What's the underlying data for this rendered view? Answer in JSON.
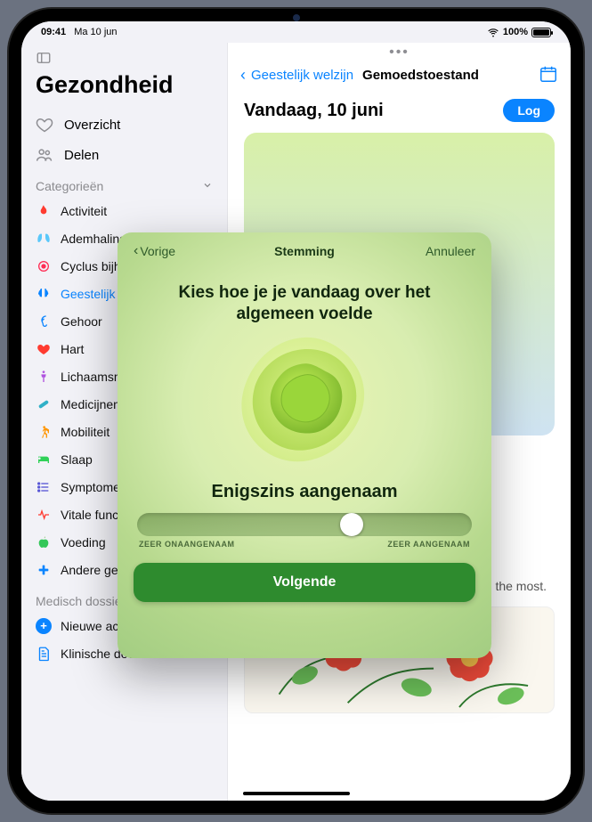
{
  "status": {
    "time": "09:41",
    "date": "Ma 10 jun",
    "battery_pct": "100%"
  },
  "sidebar": {
    "title": "Gezondheid",
    "overview": "Overzicht",
    "share": "Delen",
    "categories_header": "Categorieën",
    "categories": [
      {
        "label": "Activiteit",
        "icon": "flame",
        "color": "#ff3b30"
      },
      {
        "label": "Ademhaling",
        "icon": "lungs",
        "color": "#5ac8fa"
      },
      {
        "label": "Cyclus bijhouden",
        "icon": "cycle",
        "color": "#ff2d55"
      },
      {
        "label": "Geestelijk welzijn",
        "icon": "brain",
        "color": "#0a84ff",
        "selected": true
      },
      {
        "label": "Gehoor",
        "icon": "ear",
        "color": "#0a84ff"
      },
      {
        "label": "Hart",
        "icon": "heart",
        "color": "#ff3b30"
      },
      {
        "label": "Lichaamsmetingen",
        "icon": "body",
        "color": "#af52de"
      },
      {
        "label": "Medicijnen",
        "icon": "pill",
        "color": "#30b0c7"
      },
      {
        "label": "Mobiliteit",
        "icon": "walk",
        "color": "#ff9500"
      },
      {
        "label": "Slaap",
        "icon": "bed",
        "color": "#30d158"
      },
      {
        "label": "Symptomen",
        "icon": "list",
        "color": "#5856d6"
      },
      {
        "label": "Vitale functies",
        "icon": "vitals",
        "color": "#ff3b30"
      },
      {
        "label": "Voeding",
        "icon": "apple",
        "color": "#34c759"
      },
      {
        "label": "Andere gegevens",
        "icon": "plus",
        "color": "#0a84ff"
      }
    ],
    "records_header": "Medisch dossier",
    "records": [
      {
        "label": "Nieuwe account",
        "icon": "plus-circle"
      },
      {
        "label": "Klinische documenten",
        "icon": "document"
      }
    ]
  },
  "main": {
    "breadcrumb_parent": "Geestelijk welzijn",
    "breadcrumb_current": "Gemoedstoestand",
    "today_title": "Vandaag, 10 juni",
    "log_button": "Log",
    "description_tail": "…otions …entary …ntify …ate of …cting you the most."
  },
  "modal": {
    "back": "Vorige",
    "title": "Stemming",
    "cancel": "Annuleer",
    "prompt": "Kies hoe je je vandaag over het algemeen voelde",
    "mood_label": "Enigszins aangenaam",
    "slider": {
      "min_label": "ZEER ONAANGENAAM",
      "max_label": "ZEER AANGENAAM",
      "value_pct": 64
    },
    "next": "Volgende"
  }
}
